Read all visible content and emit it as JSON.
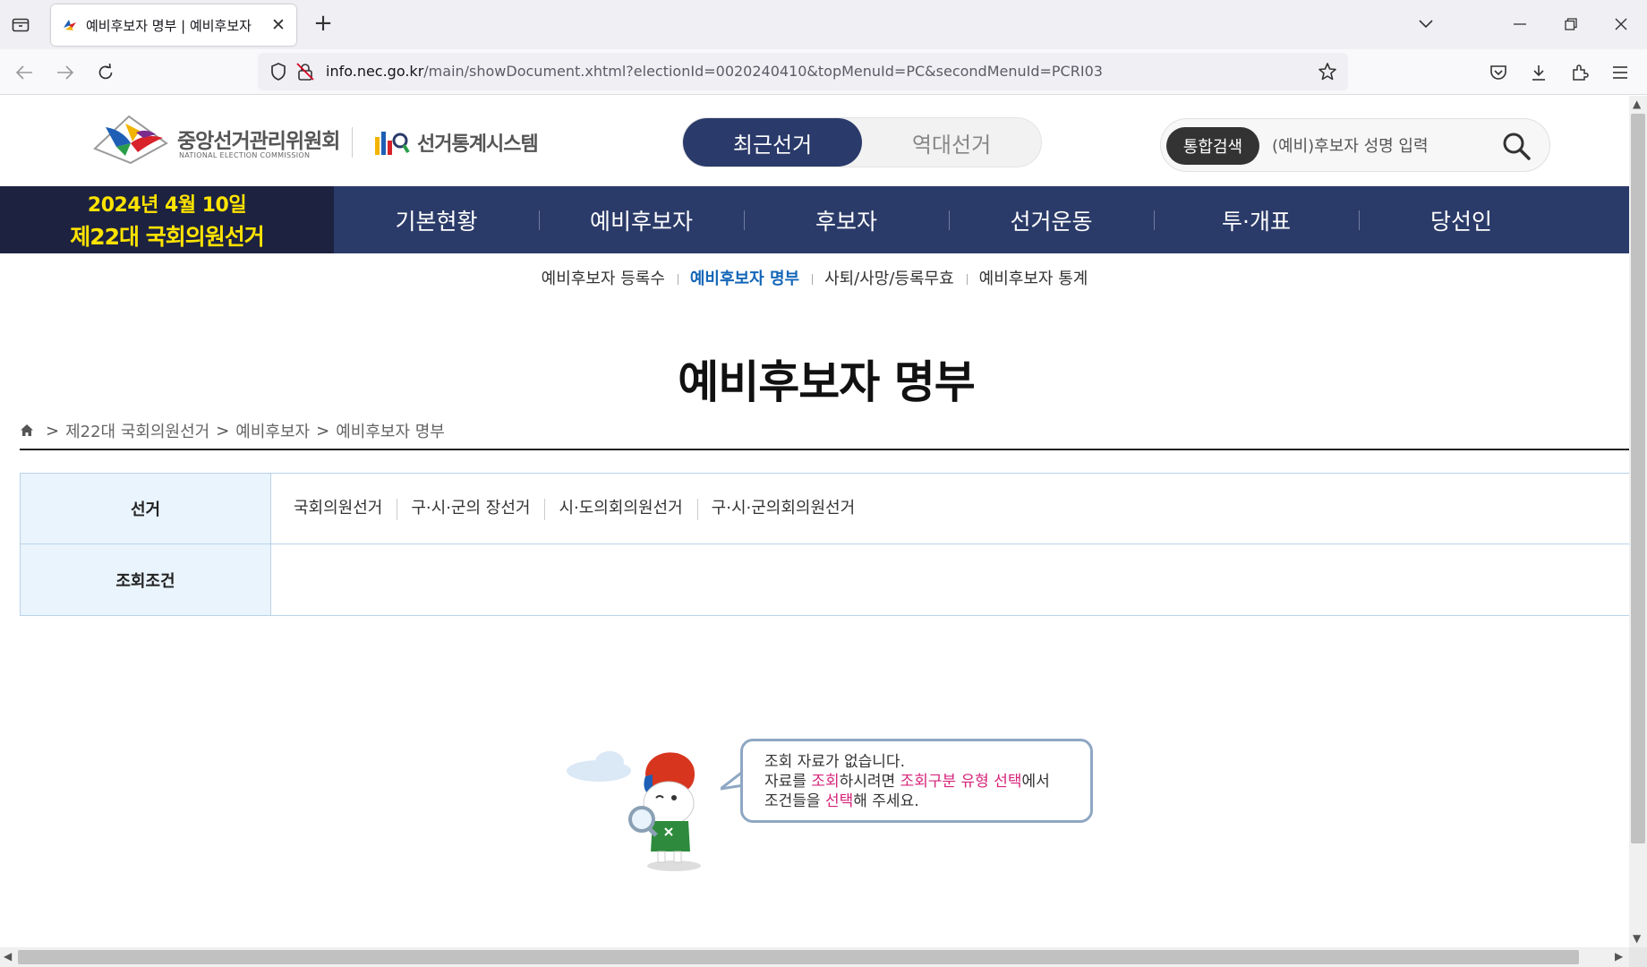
{
  "browser": {
    "tab_title": "예비후보자 명부 | 예비후보자",
    "url_domain": "info.nec.go.kr",
    "url_path": "/main/showDocument.xhtml?electionId=0020240410&topMenuId=PC&secondMenuId=PCRI03"
  },
  "header": {
    "org_name_kr": "중앙선거관리위원회",
    "org_name_en": "NATIONAL ELECTION COMMISSION",
    "system_name": "선거통계시스템",
    "toggle_recent": "최근선거",
    "toggle_past": "역대선거",
    "search_chip": "통합검색",
    "search_placeholder": "(예비)후보자 성명 입력"
  },
  "gnb": {
    "date": "2024년 4월 10일",
    "election": "제22대 국회의원선거",
    "items": [
      "기본현황",
      "예비후보자",
      "후보자",
      "선거운동",
      "투·개표",
      "당선인"
    ]
  },
  "subnav": {
    "items": [
      "예비후보자 등록수",
      "예비후보자 명부",
      "사퇴/사망/등록무효",
      "예비후보자 통계"
    ]
  },
  "page_title": "예비후보자 명부",
  "breadcrumb": {
    "sep": ">",
    "items": [
      "제22대 국회의원선거",
      "예비후보자",
      "예비후보자 명부"
    ]
  },
  "filter": {
    "row1_label": "선거",
    "row1_options": [
      "국회의원선거",
      "구·시·군의 장선거",
      "시·도의회의원선거",
      "구·시·군의회의원선거"
    ],
    "row2_label": "조회조건"
  },
  "empty": {
    "line1": "조회 자료가 없습니다.",
    "line2_a": "자료를 ",
    "line2_b": "조회",
    "line2_c": "하시려면 ",
    "line2_d": "조회구분 유형 선택",
    "line2_e": "에서",
    "line3_a": "조건들을 ",
    "line3_b": "선택",
    "line3_c": "해 주세요."
  },
  "colors": {
    "gnb_bg": "#2b3b69",
    "gnb_date_bg": "#1c2240",
    "accent_yellow": "#ffe300",
    "active_link": "#1366b8",
    "highlight_pink": "#d6247a"
  }
}
